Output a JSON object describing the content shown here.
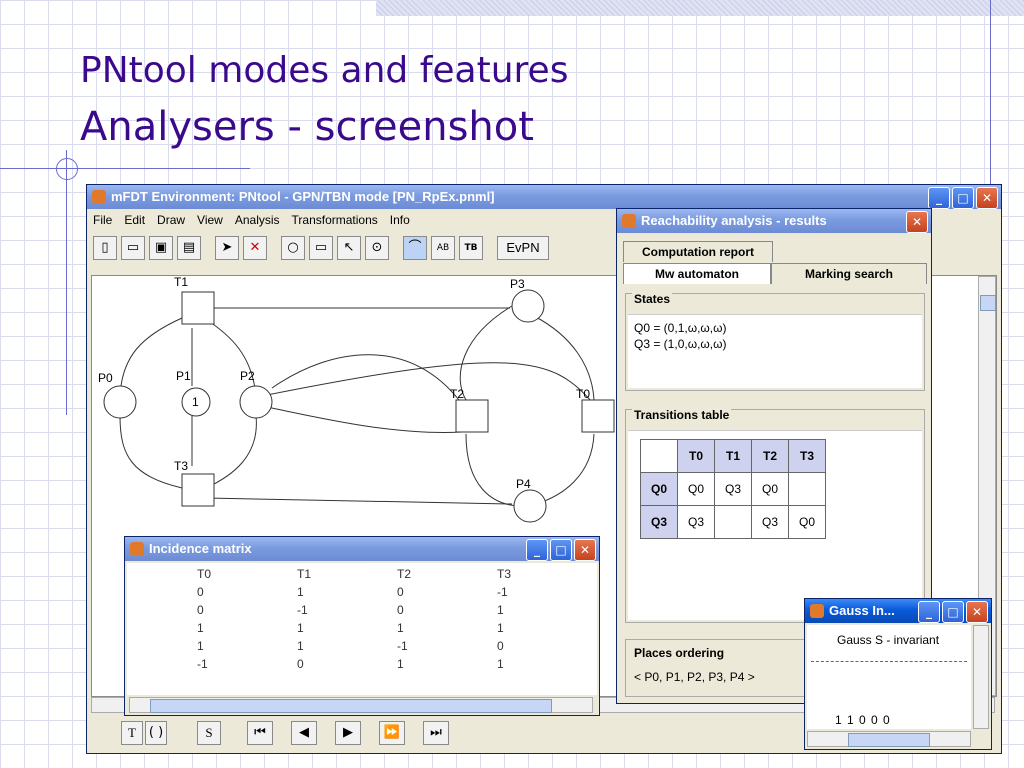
{
  "slide": {
    "title_line1": "PNtool modes and features",
    "title_line2": "Analysers - screenshot"
  },
  "main_window": {
    "title": "mFDT Environment: PNtool - GPN/TBN mode [PN_RpEx.pnml]",
    "menu": [
      "File",
      "Edit",
      "Draw",
      "View",
      "Analysis",
      "Transformations",
      "Info"
    ],
    "toolbar_text": {
      "ab": "AB",
      "tb": "TB",
      "evpn": "EvPN"
    },
    "bottom_buttons": [
      "T",
      "( )",
      "S"
    ],
    "places": [
      {
        "name": "P0",
        "tokens": ""
      },
      {
        "name": "P1",
        "tokens": "1"
      },
      {
        "name": "P2",
        "tokens": ""
      },
      {
        "name": "P3",
        "tokens": ""
      },
      {
        "name": "P4",
        "tokens": ""
      }
    ],
    "transitions": [
      "T0",
      "T1",
      "T2",
      "T3"
    ]
  },
  "reachability": {
    "title": "Reachability analysis - results",
    "tabs": {
      "top": "Computation report",
      "active": "Mw automaton",
      "other": "Marking search"
    },
    "states_label": "States",
    "states": [
      "Q0 = (0,1,ω,ω,ω)",
      "Q3 = (1,0,ω,ω,ω)"
    ],
    "transitions_label": "Transitions table",
    "table": {
      "cols": [
        "T0",
        "T1",
        "T2",
        "T3"
      ],
      "rows": [
        {
          "head": "Q0",
          "cells": [
            "Q0",
            "Q3",
            "Q0",
            ""
          ]
        },
        {
          "head": "Q3",
          "cells": [
            "Q3",
            "",
            "Q3",
            "Q0"
          ]
        }
      ]
    },
    "places_label": "Places ordering",
    "places_value": "< P0, P1, P2, P3, P4 >"
  },
  "incidence": {
    "title": "Incidence matrix",
    "headers": [
      "T0",
      "T1",
      "T2",
      "T3"
    ],
    "rows": [
      [
        "0",
        "1",
        "0",
        "-1"
      ],
      [
        "0",
        "-1",
        "0",
        "1"
      ],
      [
        "1",
        "1",
        "1",
        "1"
      ],
      [
        "1",
        "1",
        "-1",
        "0"
      ],
      [
        "-1",
        "0",
        "1",
        "1"
      ]
    ]
  },
  "gauss": {
    "title": "Gauss In...",
    "subtitle": "Gauss S - invariant",
    "value": "1 1 0 0 0"
  }
}
